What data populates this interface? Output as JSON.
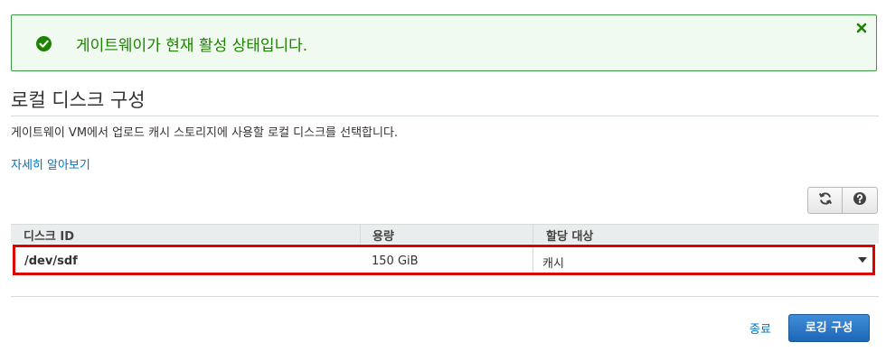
{
  "banner": {
    "message": "게이트웨이가 현재 활성 상태입니다.",
    "icon": "check-circle-icon",
    "close_icon": "close-icon",
    "color": "#1d8102"
  },
  "section": {
    "title": "로컬 디스크 구성",
    "description": "게이트웨이 VM에서 업로드 캐시 스토리지에 사용할 로컬 디스크를 선택합니다.",
    "learn_more": "자세히 알아보기"
  },
  "toolbar": {
    "refresh_icon": "refresh-icon",
    "help_icon": "help-icon"
  },
  "table": {
    "columns": [
      "디스크 ID",
      "용량",
      "할당 대상"
    ],
    "rows": [
      {
        "disk_id": "/dev/sdf",
        "capacity": "150 GiB",
        "allocation": "캐시"
      }
    ]
  },
  "footer": {
    "cancel_label": "종료",
    "submit_label": "로깅 구성"
  },
  "colors": {
    "link": "#0073bb",
    "highlight_border": "#e00000",
    "primary_button": "#1e66b8"
  }
}
